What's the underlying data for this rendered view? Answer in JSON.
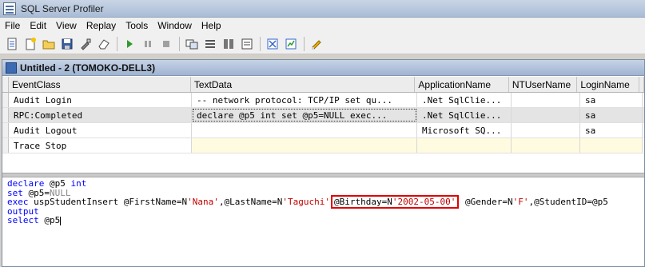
{
  "app": {
    "title": "SQL Server Profiler"
  },
  "menu": [
    "File",
    "Edit",
    "View",
    "Replay",
    "Tools",
    "Window",
    "Help"
  ],
  "toolbar": {
    "buttons": [
      "new-trace-icon",
      "new-template-icon",
      "open-icon",
      "save-icon",
      "properties-icon",
      "clear-icon",
      "run-icon",
      "pause-icon",
      "stop-icon",
      "activity-monitor-icon",
      "settings-icon",
      "find-icon",
      "clear-window-icon",
      "import-icon",
      "export-icon",
      "help-icon"
    ]
  },
  "window": {
    "title": "Untitled - 2 (TOMOKO-DELL3)",
    "columns": [
      "EventClass",
      "TextData",
      "ApplicationName",
      "NTUserName",
      "LoginName"
    ],
    "rows": [
      {
        "event": "Audit Login",
        "text": "-- network protocol: TCP/IP  set qu...",
        "app": ".Net SqlClie...",
        "ntuser": "",
        "login": "sa"
      },
      {
        "event": "RPC:Completed",
        "text": "declare @p5 int  set @p5=NULL  exec...",
        "app": ".Net SqlClie...",
        "ntuser": "",
        "login": "sa"
      },
      {
        "event": "Audit Logout",
        "text": "",
        "app": "Microsoft SQ...",
        "ntuser": "",
        "login": "sa"
      },
      {
        "event": "Trace Stop",
        "text": "",
        "app": "",
        "ntuser": "",
        "login": ""
      }
    ]
  },
  "sql": {
    "line1_kw": "declare",
    "line1_rest": " @p5 ",
    "line1_type": "int",
    "line2_kw": "set",
    "line2_rest": " @p5=",
    "line2_null": "NULL",
    "line3_kw": "exec",
    "line3_proc": " uspStudentInsert @FirstName=N",
    "line3_first": "'Nana'",
    "line3_mid": ",@LastName=N",
    "line3_last": "'Taguchi'",
    "line3_bd_name": "@Birthday=N",
    "line3_bd_val": "'2002-05-00'",
    "line3_after": " @Gender=N",
    "line3_gender": "'F'",
    "line3_end": ",@StudentID=@p5",
    "line4": "output",
    "line5_kw": "select",
    "line5_rest": " @p5"
  },
  "colors": {
    "keyword": "#0000ff",
    "string": "#c00000",
    "highlight": "#e00000"
  }
}
